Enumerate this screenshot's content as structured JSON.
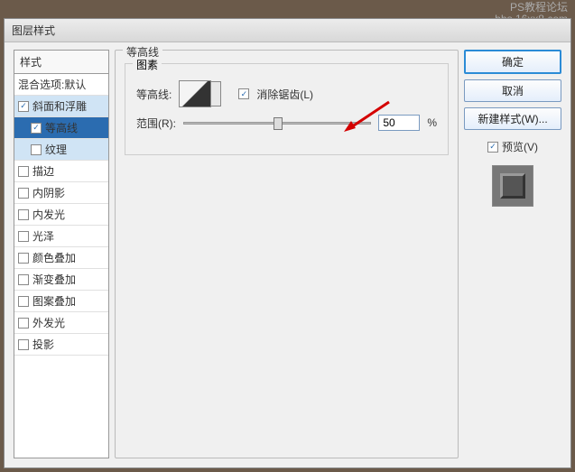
{
  "watermark": {
    "line1": "PS教程论坛",
    "line2": "bbs.16xx8.com"
  },
  "dialog": {
    "title": "图层样式"
  },
  "styles": {
    "header": "样式",
    "blend": "混合选项:默认",
    "bevel": "斜面和浮雕",
    "contour": "等高线",
    "texture": "纹理",
    "stroke": "描边",
    "innerShadow": "内阴影",
    "innerGlow": "内发光",
    "satin": "光泽",
    "colorOverlay": "颜色叠加",
    "gradientOverlay": "渐变叠加",
    "patternOverlay": "图案叠加",
    "outerGlow": "外发光",
    "dropShadow": "投影"
  },
  "main": {
    "groupTitle": "等高线",
    "elementsTitle": "图素",
    "contourLabel": "等高线:",
    "antiAlias": "消除锯齿(L)",
    "rangeLabel": "范围(R):",
    "rangeValue": "50",
    "percent": "%"
  },
  "buttons": {
    "ok": "确定",
    "cancel": "取消",
    "newStyle": "新建样式(W)...",
    "preview": "预览(V)"
  }
}
